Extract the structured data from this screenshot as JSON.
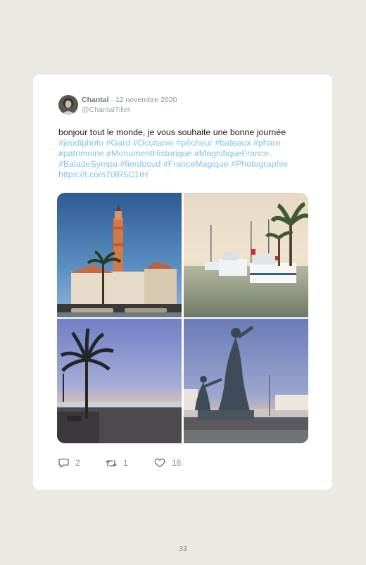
{
  "tweet": {
    "author_name": "Chantal",
    "separator": " · ",
    "date": "12 novembre 2020",
    "handle": "@ChantalTillet",
    "text": "bonjour tout le monde, je vous souhaite une bonne journée",
    "hashtags": [
      "#jeudiphoto",
      "#Gard",
      "#Occitanie",
      "#pêcheur",
      "#bateaux",
      "#phare",
      "#patrimoine",
      "#MonumentHistorique",
      "#MagnifiqueFrance",
      "#BaladeSympa",
      "#fierdusud",
      "#FranceMagique",
      "#Photographie"
    ],
    "link": "https://t.co/s70lR5C1tH",
    "photos": [
      {
        "subject": "lighthouse-photo"
      },
      {
        "subject": "harbor-boats-photo"
      },
      {
        "subject": "palm-tree-beach-photo"
      },
      {
        "subject": "statue-woman-child-photo"
      }
    ],
    "actions": {
      "reply_icon": "reply-icon",
      "reply_count": "2",
      "retweet_icon": "retweet-icon",
      "retweet_count": "1",
      "like_icon": "heart-icon",
      "like_count": "18"
    }
  },
  "colors": {
    "page_background": "#ece8e4",
    "card_background": "#ffffff",
    "hashtag_blue": "#7fc4ec",
    "muted_gray": "#8a949e"
  },
  "page": {
    "number": "33"
  }
}
